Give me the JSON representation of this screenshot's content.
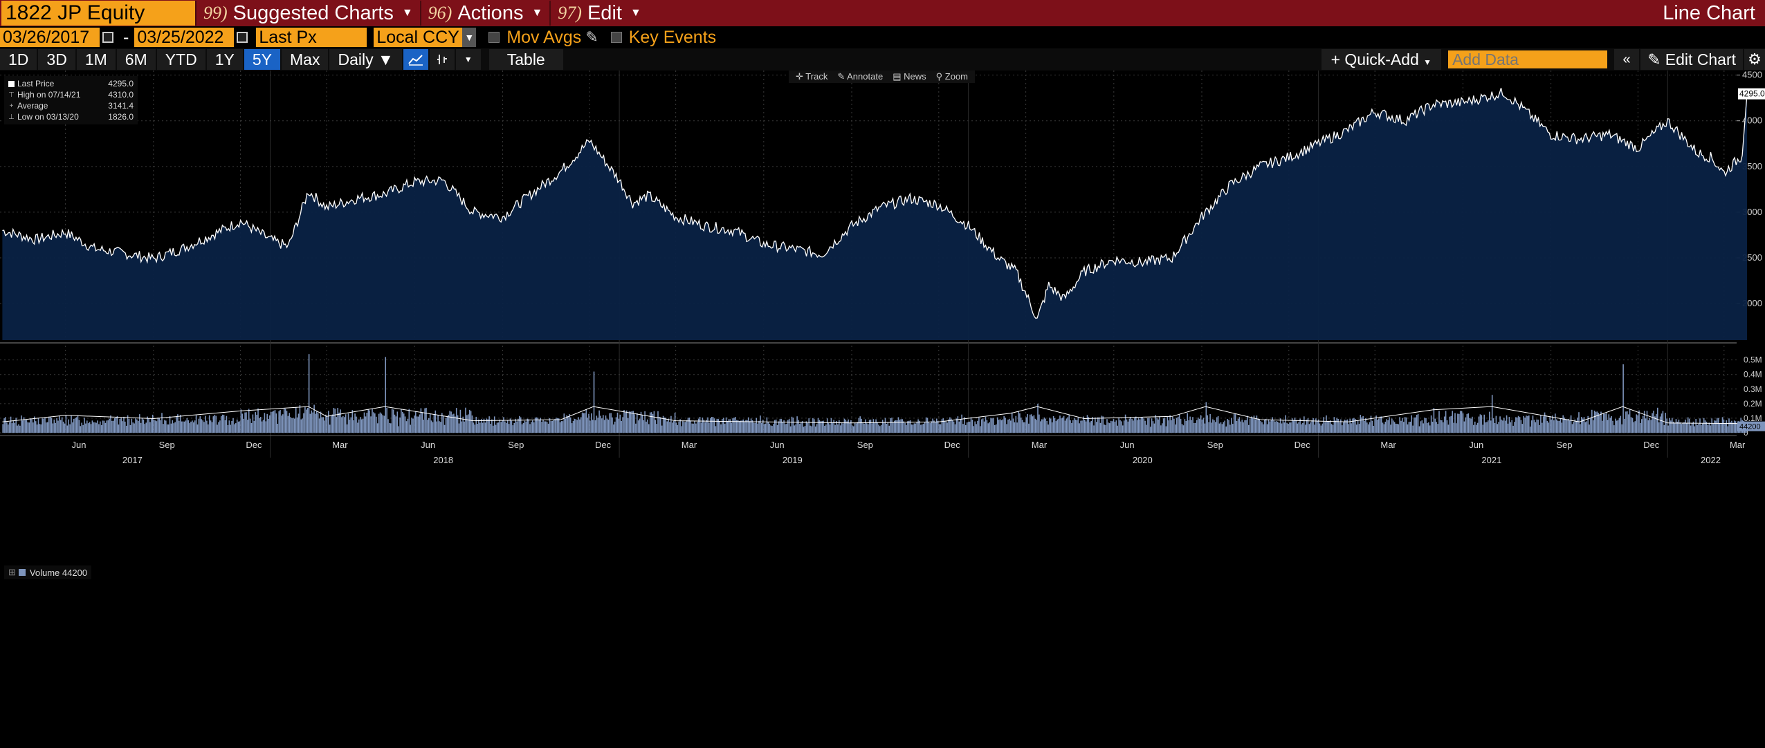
{
  "header": {
    "ticker": "1822 JP Equity",
    "menus": [
      {
        "num": "99)",
        "label": "Suggested Charts"
      },
      {
        "num": "96)",
        "label": "Actions"
      },
      {
        "num": "97)",
        "label": "Edit"
      }
    ],
    "chart_type": "Line Chart"
  },
  "dates": {
    "start": "03/26/2017",
    "dash": "-",
    "end": "03/25/2022",
    "field": "Last Px",
    "currency": "Local CCY",
    "mov_avgs": "Mov Avgs",
    "key_events": "Key Events"
  },
  "ranges": {
    "buttons": [
      "1D",
      "3D",
      "1M",
      "6M",
      "YTD",
      "1Y",
      "5Y",
      "Max"
    ],
    "active": "5Y",
    "period": "Daily",
    "table": "Table",
    "quick_add": "Quick-Add",
    "add_data_placeholder": "Add Data",
    "edit_chart": "Edit Chart"
  },
  "tools": [
    "Track",
    "Annotate",
    "News",
    "Zoom"
  ],
  "legend": {
    "last_label": "Last Price",
    "last_value": "4295.0",
    "high_label": "High on 07/14/21",
    "high_value": "4310.0",
    "avg_label": "Average",
    "avg_value": "3141.4",
    "low_label": "Low on 03/13/20",
    "low_value": "1826.0"
  },
  "volume_legend": {
    "label": "Volume",
    "value": "44200"
  },
  "colors": {
    "line": "#ffffff",
    "area": "#0a2244",
    "volume_bars": "#7e95bd",
    "grid": "#3a3a3a",
    "accent": "#f5a11a",
    "header": "#7d1019"
  },
  "chart_data": [
    {
      "type": "area",
      "series": [
        {
          "name": "Last Price"
        }
      ],
      "ylim": [
        1600,
        4550
      ],
      "yticks": [
        2000,
        2500,
        3000,
        3500,
        4000,
        4500
      ],
      "last_value_label": "4295.0",
      "x": [
        "2017-03-27",
        "2017-05-01",
        "2017-06-01",
        "2017-07-01",
        "2017-08-01",
        "2017-09-01",
        "2017-10-01",
        "2017-11-01",
        "2017-12-01",
        "2018-01-01",
        "2018-01-20",
        "2018-02-10",
        "2018-03-01",
        "2018-04-01",
        "2018-05-01",
        "2018-06-01",
        "2018-07-01",
        "2018-08-01",
        "2018-09-01",
        "2018-10-01",
        "2018-11-01",
        "2018-12-01",
        "2019-01-01",
        "2019-01-15",
        "2019-02-01",
        "2019-03-01",
        "2019-04-01",
        "2019-05-01",
        "2019-06-01",
        "2019-07-01",
        "2019-08-01",
        "2019-09-01",
        "2019-10-01",
        "2019-11-01",
        "2019-12-01",
        "2020-01-01",
        "2020-02-01",
        "2020-02-20",
        "2020-03-13",
        "2020-03-25",
        "2020-04-10",
        "2020-05-01",
        "2020-06-01",
        "2020-07-01",
        "2020-08-01",
        "2020-09-01",
        "2020-10-01",
        "2020-11-01",
        "2020-12-01",
        "2021-01-01",
        "2021-02-01",
        "2021-03-01",
        "2021-04-01",
        "2021-05-01",
        "2021-06-01",
        "2021-07-14",
        "2021-08-01",
        "2021-09-01",
        "2021-10-01",
        "2021-11-01",
        "2021-12-01",
        "2022-01-01",
        "2022-02-01",
        "2022-02-15",
        "2022-03-01",
        "2022-03-20",
        "2022-03-25"
      ],
      "y": [
        2800,
        2700,
        2780,
        2600,
        2550,
        2490,
        2600,
        2750,
        2900,
        2700,
        2620,
        3230,
        3050,
        3150,
        3200,
        3330,
        3350,
        3000,
        2950,
        3200,
        3450,
        3780,
        3350,
        3100,
        3180,
        2950,
        2850,
        2800,
        2650,
        2600,
        2540,
        2850,
        3050,
        3150,
        3080,
        2850,
        2500,
        2350,
        1826,
        2200,
        2050,
        2350,
        2480,
        2450,
        2500,
        2950,
        3300,
        3500,
        3600,
        3750,
        3900,
        4100,
        4000,
        4180,
        4200,
        4310,
        4150,
        3850,
        3800,
        3850,
        3700,
        4000,
        3650,
        3600,
        3430,
        3620,
        4295
      ]
    },
    {
      "type": "bar",
      "series": [
        {
          "name": "Volume"
        }
      ],
      "ylim": [
        0,
        560000
      ],
      "ytick_labels": [
        "0",
        "0.1M",
        "0.2M",
        "0.3M",
        "0.4M",
        "0.5M"
      ],
      "last_value_label": "44200",
      "x": [
        "2017-03-27",
        "2017-06-01",
        "2017-09-01",
        "2017-12-01",
        "2018-02-10",
        "2018-03-01",
        "2018-05-01",
        "2018-08-01",
        "2018-11-01",
        "2018-12-05",
        "2019-03-01",
        "2019-06-01",
        "2019-09-01",
        "2019-12-01",
        "2020-02-15",
        "2020-03-13",
        "2020-05-01",
        "2020-08-01",
        "2020-09-05",
        "2020-11-01",
        "2021-02-01",
        "2021-05-01",
        "2021-07-01",
        "2021-10-01",
        "2021-11-15",
        "2022-01-01",
        "2022-03-25"
      ],
      "y": [
        60000,
        120000,
        90000,
        160000,
        540000,
        110000,
        520000,
        70000,
        80000,
        420000,
        70000,
        60000,
        50000,
        60000,
        140000,
        200000,
        90000,
        110000,
        210000,
        80000,
        60000,
        170000,
        260000,
        60000,
        470000,
        50000,
        44200
      ]
    }
  ],
  "x_axis": {
    "months": [
      "Jun",
      "Sep",
      "Dec",
      "Mar",
      "Jun",
      "Sep",
      "Dec",
      "Mar",
      "Jun",
      "Sep",
      "Dec",
      "Mar",
      "Jun",
      "Sep",
      "Dec",
      "Mar",
      "Jun",
      "Sep",
      "Dec",
      "Mar"
    ],
    "years": [
      "2017",
      "2018",
      "2019",
      "2020",
      "2021",
      "2022"
    ]
  }
}
